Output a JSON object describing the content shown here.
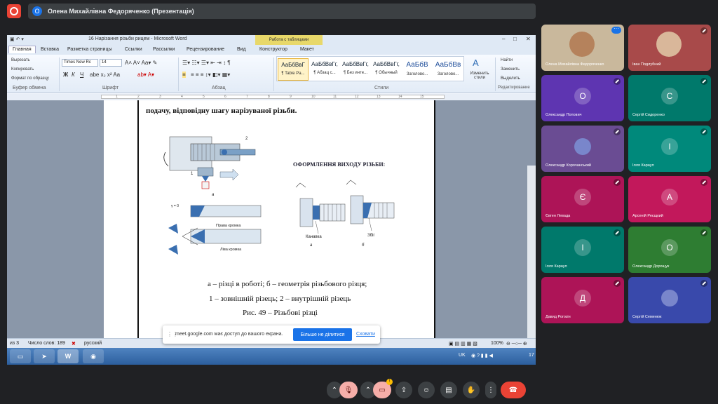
{
  "meet": {
    "presenter_initial": "О",
    "presentation_title": "Олена Михайлівна Федоряченко (Презентація)",
    "share_bar": {
      "message": "meet.google.com має доступ до вашого екрана.",
      "stop_label": "Більше не ділитися",
      "hide_label": "Сховати"
    },
    "participants": [
      {
        "name": "Олена Михайлівна Федоряченко",
        "initial": "",
        "color": "#c9b89c",
        "muted": false,
        "video": true
      },
      {
        "name": "Іван Подлубний",
        "initial": "",
        "color": "#a84a4a",
        "muted": true,
        "video": true
      },
      {
        "name": "Олександр Попович",
        "initial": "О",
        "color": "#5e35b1",
        "muted": true,
        "video": false
      },
      {
        "name": "Сергій Сидоренко",
        "initial": "С",
        "color": "#00796b",
        "muted": true,
        "video": false
      },
      {
        "name": "Олександр Корочанський",
        "initial": "",
        "color": "#6a4c93",
        "muted": true,
        "video": false
      },
      {
        "name": "Ілля Караул",
        "initial": "І",
        "color": "#00897b",
        "muted": true,
        "video": false
      },
      {
        "name": "Євген Левада",
        "initial": "Є",
        "color": "#ad1457",
        "muted": true,
        "video": false
      },
      {
        "name": "Арсеній Реєщкий",
        "initial": "А",
        "color": "#c2185b",
        "muted": true,
        "video": false
      },
      {
        "name": "Ілля Караул",
        "initial": "І",
        "color": "#00796b",
        "muted": true,
        "video": false
      },
      {
        "name": "Олександр Дорощук",
        "initial": "О",
        "color": "#2e7d32",
        "muted": true,
        "video": false
      },
      {
        "name": "Давид Рогозін",
        "initial": "Д",
        "color": "#ad1457",
        "muted": true,
        "video": false
      },
      {
        "name": "Сергій Семенюк",
        "initial": "",
        "color": "#3949ab",
        "muted": true,
        "video": false
      }
    ]
  },
  "word": {
    "document_title": "16 Нарізання різьби рицем  -  Microsoft Word",
    "context_tab": "Работа с таблицами",
    "tabs": [
      "Главная",
      "Вставка",
      "Разметка страницы",
      "Ссылки",
      "Рассылки",
      "Рецензирование",
      "Вид",
      "Конструктор",
      "Макет"
    ],
    "clipboard": {
      "cut": "Вырезать",
      "copy": "Копировать",
      "format": "Формат по образцу",
      "group": "Буфер обмена"
    },
    "font": {
      "name": "Times New Rc",
      "size": "14",
      "group": "Шрифт"
    },
    "paragraph_group": "Абзац",
    "styles": {
      "items": [
        {
          "sample": "АаБбВвГ",
          "name": "¶ Table Pa..."
        },
        {
          "sample": "АаБбВвГг,",
          "name": "¶ Абзац с..."
        },
        {
          "sample": "АаБбВвГг,",
          "name": "¶ Без инте..."
        },
        {
          "sample": "АаБбВвГг,",
          "name": "¶ Обычный"
        },
        {
          "sample": "АаБбВ",
          "name": "Заголово..."
        },
        {
          "sample": "АаБбВв",
          "name": "Заголово..."
        }
      ],
      "change_label": "Изменить стили",
      "group": "Стили"
    },
    "editing": {
      "find": "Найти",
      "replace": "Заменить",
      "select": "Выделить",
      "group": "Редактирование"
    },
    "ruler_marks": [
      "1",
      "2",
      "3",
      "4",
      "5",
      "6",
      "7",
      "8",
      "9",
      "10",
      "11",
      "12",
      "13",
      "14",
      "15"
    ],
    "body": {
      "line1": "подачу, відповідну шагу нарізуваної різьби.",
      "figure_heading": "ОФОРМЛЕННЯ ВИХОДУ РІЗЬБИ:",
      "figure_labels": {
        "left_a": "а",
        "right_edge": "Права кромка",
        "left_edge": "Ліва кромка",
        "gamma": "γ = 0",
        "groove": "Канавка",
        "a": "а",
        "b": "б",
        "undercut": "Збіг",
        "n1": "1",
        "n2": "2"
      },
      "caption_a": "а – різці в роботі; б – геометрія різьбового різця;",
      "caption_b": "1 – зовнішній різець; 2 – внутрішній різець",
      "caption_c": "Рис. 49 – Різьбові різці"
    },
    "status": {
      "page": "из 3",
      "words": "Число слов: 189",
      "language": "русский",
      "zoom": "100%"
    },
    "taskbar": {
      "lang": "UK",
      "clock": "17"
    }
  }
}
